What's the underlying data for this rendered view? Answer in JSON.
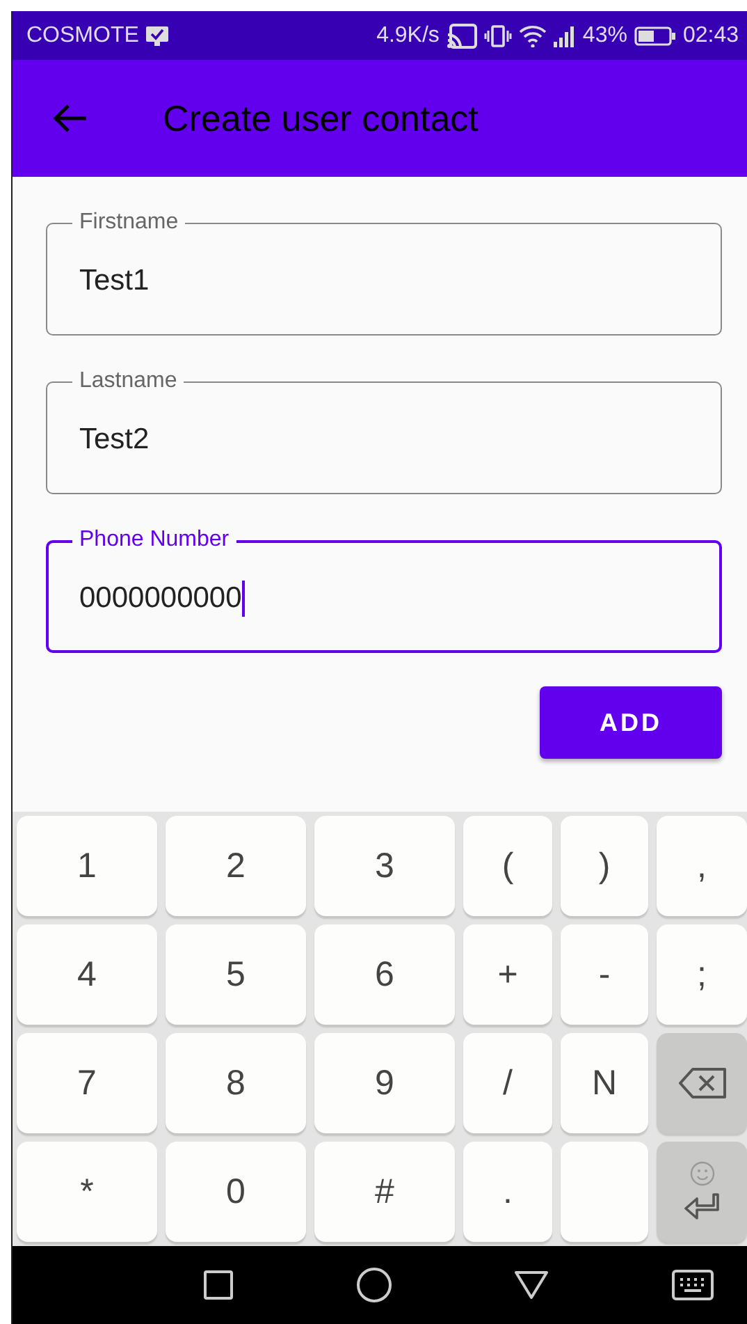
{
  "status_bar": {
    "carrier": "COSMOTE",
    "speed": "4.9K/s",
    "battery": "43%",
    "time": "02:43"
  },
  "app_bar": {
    "title": "Create user contact"
  },
  "fields": [
    {
      "label": "Firstname",
      "value": "Test1",
      "focused": false
    },
    {
      "label": "Lastname",
      "value": "Test2",
      "focused": false
    },
    {
      "label": "Phone Number",
      "value": "0000000000",
      "focused": true
    }
  ],
  "button": "ADD",
  "keyboard": [
    {
      "kind": "char",
      "label": "1"
    },
    {
      "kind": "char",
      "label": "2"
    },
    {
      "kind": "char",
      "label": "3"
    },
    {
      "kind": "char",
      "label": "("
    },
    {
      "kind": "char",
      "label": ")"
    },
    {
      "kind": "char",
      "label": ","
    },
    {
      "kind": "char",
      "label": "4"
    },
    {
      "kind": "char",
      "label": "5"
    },
    {
      "kind": "char",
      "label": "6"
    },
    {
      "kind": "char",
      "label": "+"
    },
    {
      "kind": "char",
      "label": "-"
    },
    {
      "kind": "char",
      "label": ";"
    },
    {
      "kind": "char",
      "label": "7"
    },
    {
      "kind": "char",
      "label": "8"
    },
    {
      "kind": "char",
      "label": "9"
    },
    {
      "kind": "char",
      "label": "/"
    },
    {
      "kind": "char",
      "label": "N"
    },
    {
      "kind": "backspace"
    },
    {
      "kind": "char",
      "label": "*"
    },
    {
      "kind": "char",
      "label": "0"
    },
    {
      "kind": "char",
      "label": "#"
    },
    {
      "kind": "char",
      "label": "."
    },
    {
      "kind": "space"
    },
    {
      "kind": "enter"
    }
  ]
}
